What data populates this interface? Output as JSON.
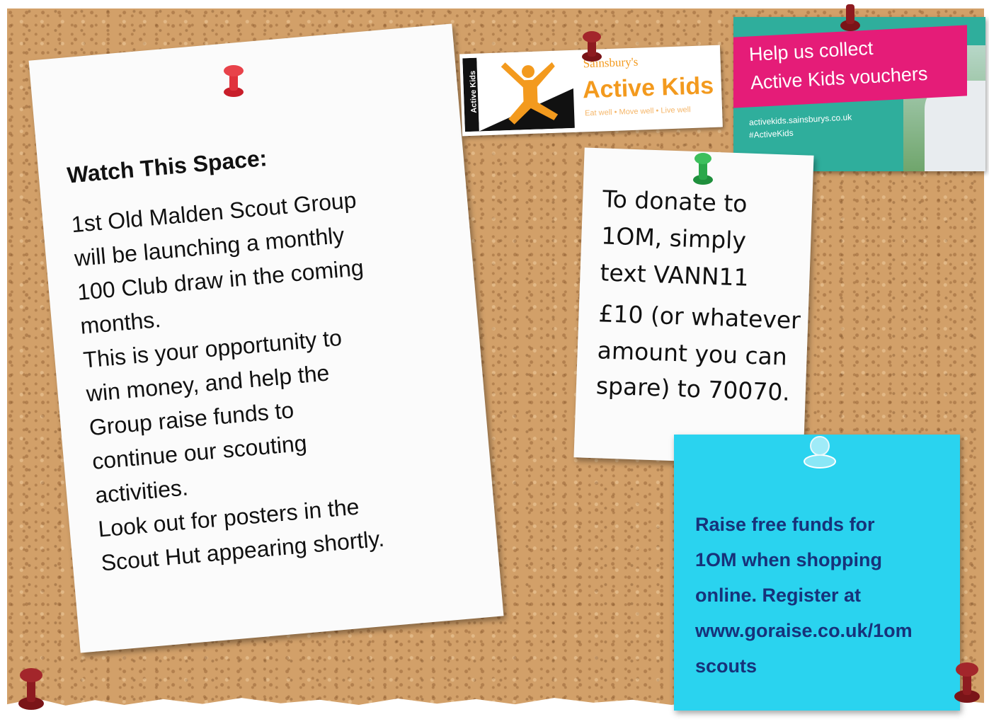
{
  "big_note": {
    "heading": "Watch This Space:",
    "lines": [
      "1st Old Malden Scout Group",
      "will be launching a monthly",
      "100 Club draw in the coming",
      "months.",
      "This is your opportunity to",
      "win money, and help the",
      "Group raise funds to",
      "continue our scouting",
      "activities.",
      "Look out for posters in the",
      "Scout Hut appearing shortly."
    ]
  },
  "donate_note": {
    "lines": [
      "To donate to",
      "1OM, simply",
      "text VANN11",
      "£10 (or whatever",
      "amount you can",
      "spare) to 70070."
    ]
  },
  "blue_note": {
    "lines": [
      "Raise free funds for",
      "1OM  when shopping",
      "online.  Register at",
      "www.goraise.co.uk/1om",
      "scouts"
    ]
  },
  "active_kids_logo": {
    "vertical_label": "Active Kids",
    "brand": "Sainsbury's",
    "title": "Active Kids",
    "tagline": "Eat well • Move well • Live well"
  },
  "voucher_banner": {
    "headline_1": "Help us collect",
    "headline_2": "Active Kids vouchers",
    "url": "activekids.sainsburys.co.uk",
    "hashtag": "#ActiveKids"
  },
  "colors": {
    "cork": "#d2a069",
    "blue_note": "#2ad3ef",
    "blue_text": "#17327a",
    "voucher_pink": "#e51c78",
    "voucher_teal": "#2fae9c",
    "sainsbury_orange": "#f39a1e"
  },
  "icons": [
    "red-pushpin-icon",
    "green-pushpin-icon",
    "clear-pushpin-icon",
    "jumping-kid-icon"
  ]
}
